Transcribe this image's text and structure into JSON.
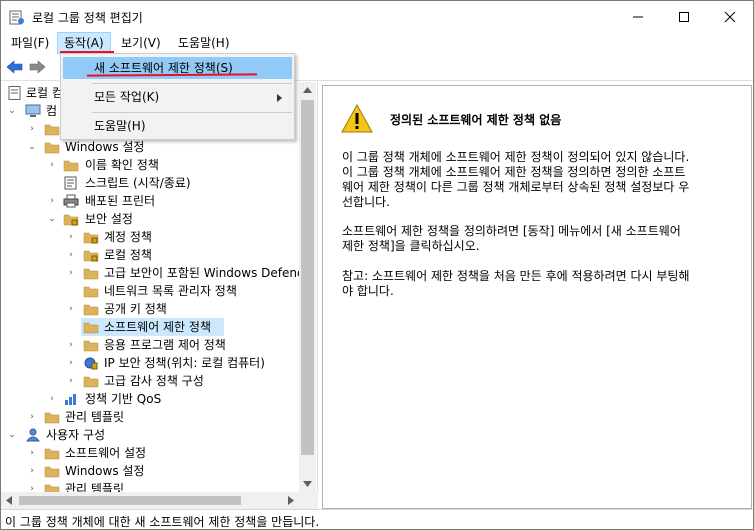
{
  "window": {
    "title": "로컬 그룹 정책 편집기"
  },
  "menubar": {
    "items": [
      {
        "label": "파일(F)"
      },
      {
        "label": "동작(A)"
      },
      {
        "label": "보기(V)"
      },
      {
        "label": "도움말(H)"
      }
    ]
  },
  "dropdown": {
    "items": [
      {
        "label": "새 소프트웨어 제한 정책(S)"
      },
      {
        "label": "모든 작업(K)"
      },
      {
        "label": "도움말(H)"
      }
    ]
  },
  "tree": {
    "items": [
      {
        "label": "로컬 컴"
      },
      {
        "label": "컴"
      },
      {
        "label": ""
      },
      {
        "label": "Windows 설정"
      },
      {
        "label": "이름 확인 정책"
      },
      {
        "label": "스크립트 (시작/종료)"
      },
      {
        "label": "배포된 프린터"
      },
      {
        "label": "보안 설정"
      },
      {
        "label": "계정 정책"
      },
      {
        "label": "로컬 정책"
      },
      {
        "label": "고급 보안이 포함된 Windows Defender"
      },
      {
        "label": "네트워크 목록 관리자 정책"
      },
      {
        "label": "공개 키 정책"
      },
      {
        "label": "소프트웨어 제한 정책"
      },
      {
        "label": "응용 프로그램 제어 정책"
      },
      {
        "label": "IP 보안 정책(위치: 로컬 컴퓨터)"
      },
      {
        "label": "고급 감사 정책 구성"
      },
      {
        "label": "정책 기반 QoS"
      },
      {
        "label": "관리 템플릿"
      },
      {
        "label": "사용자 구성"
      },
      {
        "label": "소프트웨어 설정"
      },
      {
        "label": "Windows 설정"
      },
      {
        "label": "관리 템플릿"
      }
    ]
  },
  "detail": {
    "heading": "정의된 소프트웨어 제한 정책 없음",
    "paragraph1_lines": [
      "이 그룹 정책 개체에 소프트웨어 제한 정책이 정의되어 있지 않습니다.",
      "이 그룹 정책 개체에 소프트웨어 제한 정책을 정의하면 정의한 소프트",
      "웨어 제한 정책이 다른 그룹 정책 개체로부터 상속된 정책 설정보다 우",
      "선합니다."
    ],
    "paragraph2_lines": [
      "소프트웨어 제한 정책을 정의하려면 [동작] 메뉴에서 [새 소프트웨어",
      "제한 정책]을 클릭하십시오."
    ],
    "paragraph3_lines": [
      "참고: 소프트웨어 제한 정책을 처음 만든 후에 적용하려면 다시 부팅해",
      "야 합니다."
    ]
  },
  "statusbar": {
    "text": "이 그룹 정책 개체에 대한 새 소프트웨어 제한 정책을 만듭니다."
  },
  "colors": {
    "selection": "#cce8ff",
    "menu_highlight": "#91c9f7",
    "annotation_red": "#e81123",
    "folder": "#dcb35c",
    "warning": "#f5c518"
  }
}
